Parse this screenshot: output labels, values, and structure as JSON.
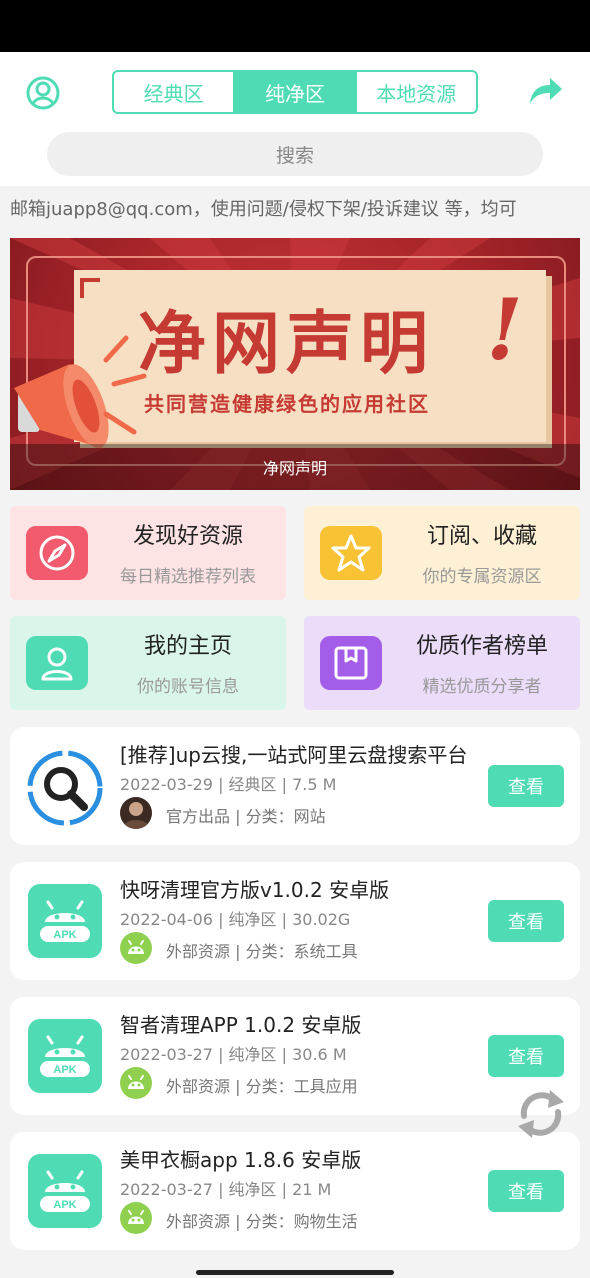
{
  "colors": {
    "accent": "#4fdcb4",
    "banner_red": "#a8252a"
  },
  "header": {
    "tabs": [
      {
        "label": "经典区",
        "active": false
      },
      {
        "label": "纯净区",
        "active": true
      },
      {
        "label": "本地资源",
        "active": false
      }
    ],
    "search_placeholder": "搜索"
  },
  "notice": "邮箱juapp8@qq.com，使用问题/侵权下架/投诉建议 等，均可",
  "banner": {
    "title": "净网声明",
    "exclaim": "!",
    "subtitle": "共同营造健康绿色的应用社区",
    "caption": "净网声明"
  },
  "shortcuts": [
    {
      "title": "发现好资源",
      "subtitle": "每日精选推荐列表",
      "icon": "compass-icon",
      "bg": "#fde3e4",
      "icon_bg": "#f25a6e"
    },
    {
      "title": "订阅、收藏",
      "subtitle": "你的专属资源区",
      "icon": "star-icon",
      "bg": "#fdf0d5",
      "icon_bg": "#f7c234"
    },
    {
      "title": "我的主页",
      "subtitle": "你的账号信息",
      "icon": "user-icon",
      "bg": "#daf5ea",
      "icon_bg": "#4fdcb4"
    },
    {
      "title": "优质作者榜单",
      "subtitle": "精选优质分享者",
      "icon": "box-icon",
      "bg": "#ebdcfa",
      "icon_bg": "#a45de8"
    }
  ],
  "items": [
    {
      "title": "[推荐]up云搜,一站式阿里云盘搜索平台",
      "meta": "2022-03-29 |  经典区 |  7.5 M",
      "source": "官方出品 |  分类：网站",
      "icon": "search-app-icon",
      "button": "查看"
    },
    {
      "title": "快呀清理官方版v1.0.2 安卓版",
      "meta": "2022-04-06 |  纯净区 |  30.02G",
      "source": "外部资源 |  分类：系统工具",
      "icon": "apk-icon",
      "button": "查看"
    },
    {
      "title": "智者清理APP 1.0.2 安卓版",
      "meta": "2022-03-27 |  纯净区 |  30.6 M",
      "source": "外部资源 |  分类：工具应用",
      "icon": "apk-icon",
      "button": "查看"
    },
    {
      "title": "美甲衣橱app 1.8.6 安卓版",
      "meta": "2022-03-27 |  纯净区 |  21 M",
      "source": "外部资源 |  分类：购物生活",
      "icon": "apk-icon",
      "button": "查看"
    }
  ],
  "apk_label": "APK"
}
